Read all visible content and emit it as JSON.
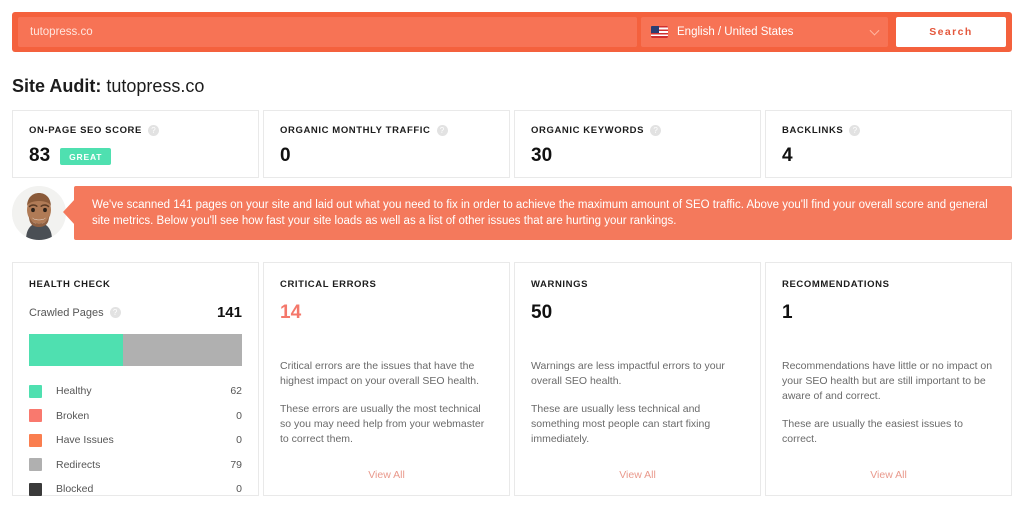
{
  "search": {
    "query_placeholder": "tutopress.co",
    "query_value": "",
    "language": "English / United States",
    "search_button": "Search",
    "bar_color": "#f4613d"
  },
  "title": {
    "prefix": "Site Audit:",
    "domain": "tutopress.co"
  },
  "metrics": [
    {
      "label": "ON-PAGE SEO SCORE",
      "value": "83",
      "badge": "GREAT",
      "badge_color": "#4fe0b0",
      "help": "?"
    },
    {
      "label": "ORGANIC MONTHLY TRAFFIC",
      "value": "0",
      "badge": "",
      "help": "?"
    },
    {
      "label": "ORGANIC KEYWORDS",
      "value": "30",
      "badge": "",
      "help": "?"
    },
    {
      "label": "BACKLINKS",
      "value": "4",
      "badge": "",
      "help": "?"
    }
  ],
  "notice": {
    "text": "We've scanned 141 pages on your site and laid out what you need to fix in order to achieve the maximum amount of SEO traffic. Above you'll find your overall score and general site metrics. Below you'll see how fast your site loads as well as a list of other issues that are hurting your rankings.",
    "background": "#f4795c"
  },
  "health_check": {
    "title": "HEALTH CHECK",
    "crawled_label": "Crawled Pages",
    "crawled_value": "141",
    "help": "?",
    "legend": [
      {
        "name": "Healthy",
        "value": "62",
        "color": "#4fe0b0"
      },
      {
        "name": "Broken",
        "value": "0",
        "color": "#f9796e"
      },
      {
        "name": "Have Issues",
        "value": "0",
        "color": "#fa7e4f"
      },
      {
        "name": "Redirects",
        "value": "79",
        "color": "#b0b0b0"
      },
      {
        "name": "Blocked",
        "value": "0",
        "color": "#3a3a3a"
      }
    ]
  },
  "panels": [
    {
      "title": "CRITICAL ERRORS",
      "count": "14",
      "count_color": "#f4786b",
      "paragraphs": [
        "Critical errors are the issues that have the highest impact on your overall SEO health.",
        "These errors are usually the most technical so you may need help from your webmaster to correct them."
      ],
      "view_all": "View All"
    },
    {
      "title": "WARNINGS",
      "count": "50",
      "count_color": "#111111",
      "paragraphs": [
        "Warnings are less impactful errors to your overall SEO health.",
        "These are usually less technical and something most people can start fixing immediately."
      ],
      "view_all": "View All"
    },
    {
      "title": "RECOMMENDATIONS",
      "count": "1",
      "count_color": "#111111",
      "paragraphs": [
        "Recommendations have little or no impact on your SEO health but are still important to be aware of and correct.",
        "These are usually the easiest issues to correct."
      ],
      "view_all": "View All"
    }
  ],
  "chart_data": {
    "type": "bar",
    "title": "Health Check — Crawled Pages",
    "categories": [
      "Healthy",
      "Broken",
      "Have Issues",
      "Redirects",
      "Blocked"
    ],
    "values": [
      62,
      0,
      0,
      79,
      0
    ],
    "colors": [
      "#4fe0b0",
      "#f9796e",
      "#fa7e4f",
      "#b0b0b0",
      "#3a3a3a"
    ],
    "total": 141,
    "stacked": true,
    "orientation": "horizontal",
    "xlabel": "",
    "ylabel": "",
    "grid": false,
    "legend_position": "below"
  }
}
